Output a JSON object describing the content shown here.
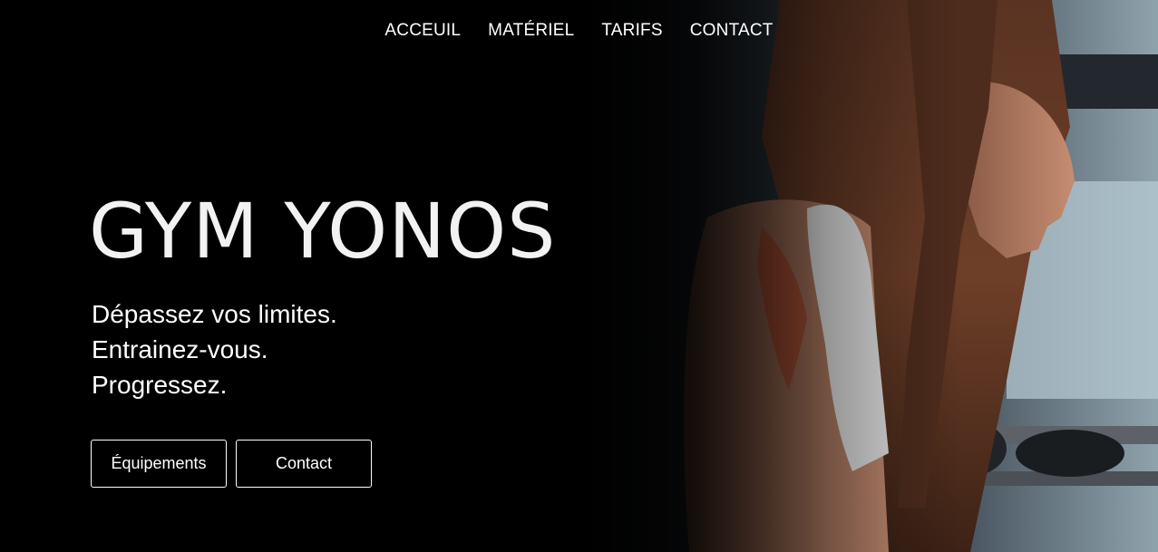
{
  "nav": {
    "items": [
      {
        "label": "ACCEUIL"
      },
      {
        "label": "MATÉRIEL"
      },
      {
        "label": "TARIFS"
      },
      {
        "label": "CONTACT"
      }
    ]
  },
  "hero": {
    "title": "GYM YONOS",
    "tagline": [
      "Dépassez vos limites.",
      "Entrainez-vous.",
      "Progressez."
    ],
    "buttons": {
      "equipment": "Équipements",
      "contact": "Contact"
    }
  },
  "colors": {
    "background": "#000000",
    "text": "#ffffff"
  }
}
